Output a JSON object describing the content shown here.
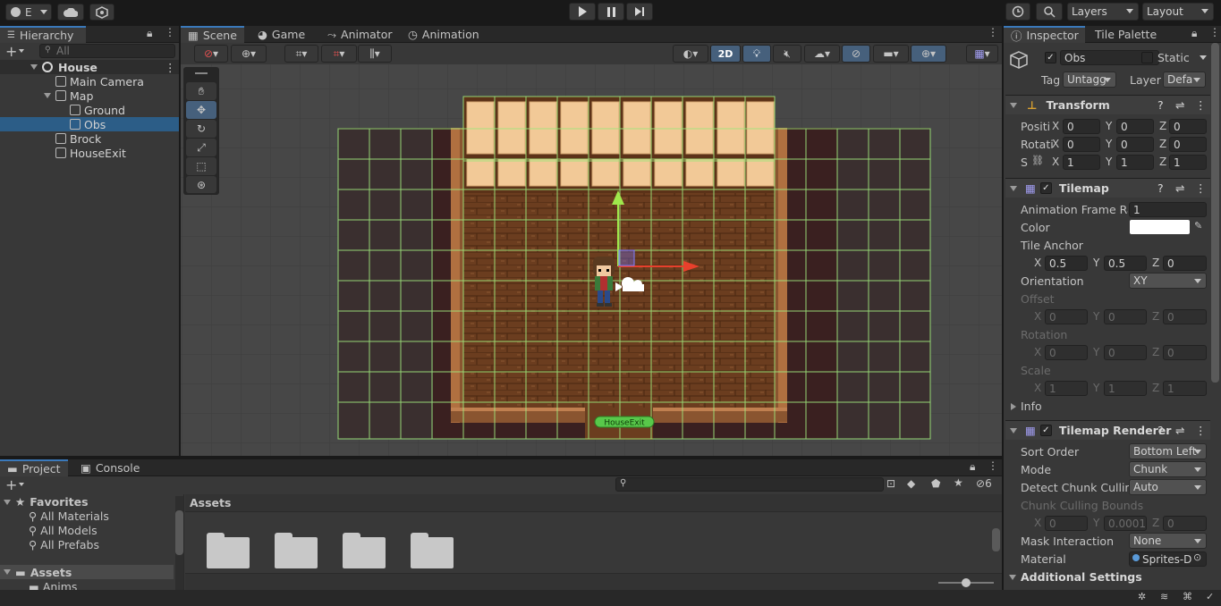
{
  "toolbar": {
    "account_label": "E",
    "layers": "Layers",
    "layout": "Layout"
  },
  "hierarchy": {
    "tab": "Hierarchy",
    "search_placeholder": "All",
    "scene": "House",
    "items": [
      {
        "label": "Main Camera"
      },
      {
        "label": "Map"
      },
      {
        "label": "Ground"
      },
      {
        "label": "Obs"
      },
      {
        "label": "Brock"
      },
      {
        "label": "HouseExit"
      }
    ]
  },
  "scene_tabs": {
    "scene": "Scene",
    "game": "Game",
    "animator": "Animator",
    "animation": "Animation"
  },
  "scene_view": {
    "mode_2d": "2D",
    "house_exit_label": "HouseExit"
  },
  "inspector": {
    "tab": "Inspector",
    "tile_palette_tab": "Tile Palette",
    "object_name": "Obs",
    "static": "Static",
    "tag_label": "Tag",
    "tag_value": "Untagg",
    "layer_label": "Layer",
    "layer_value": "Defa",
    "transform": {
      "title": "Transform",
      "position_label": "Positi",
      "rotation_label": "Rotati",
      "scale_label": "S",
      "position": [
        "0",
        "0",
        "0"
      ],
      "rotation": [
        "0",
        "0",
        "0"
      ],
      "scale": [
        "1",
        "1",
        "1"
      ]
    },
    "tilemap": {
      "title": "Tilemap",
      "anim_rate_label": "Animation Frame Rate",
      "anim_rate": "1",
      "color_label": "Color",
      "tile_anchor_label": "Tile Anchor",
      "anchor": [
        "0.5",
        "0.5",
        "0"
      ],
      "orientation_label": "Orientation",
      "orientation": "XY",
      "offset_label": "Offset",
      "offset": [
        "0",
        "0",
        "0"
      ],
      "rotation_label": "Rotation",
      "rotation": [
        "0",
        "0",
        "0"
      ],
      "scale_label": "Scale",
      "scale": [
        "1",
        "1",
        "1"
      ],
      "info_label": "Info"
    },
    "renderer": {
      "title": "Tilemap Renderer",
      "sort_order_label": "Sort Order",
      "sort_order": "Bottom Left",
      "mode_label": "Mode",
      "mode": "Chunk",
      "detect_label": "Detect Chunk Culling",
      "detect": "Auto",
      "bounds_label": "Chunk Culling Bounds",
      "bounds": [
        "0",
        "0.0001",
        "0"
      ],
      "mask_label": "Mask Interaction",
      "mask": "None",
      "material_label": "Material",
      "material": "Sprites-D"
    },
    "additional": "Additional Settings",
    "axes": [
      "X",
      "Y",
      "Z"
    ]
  },
  "project": {
    "tab": "Project",
    "console_tab": "Console",
    "favorites": "Favorites",
    "fav_items": [
      "All Materials",
      "All Models",
      "All Prefabs"
    ],
    "assets": "Assets",
    "anims": "Anims",
    "breadcrumb": "Assets",
    "hidden_count": "6"
  },
  "colors": {
    "accent": "#3a79bb",
    "selection": "#2c5d87",
    "grid": "#9fe87c",
    "floor": "#6b3d1f"
  }
}
